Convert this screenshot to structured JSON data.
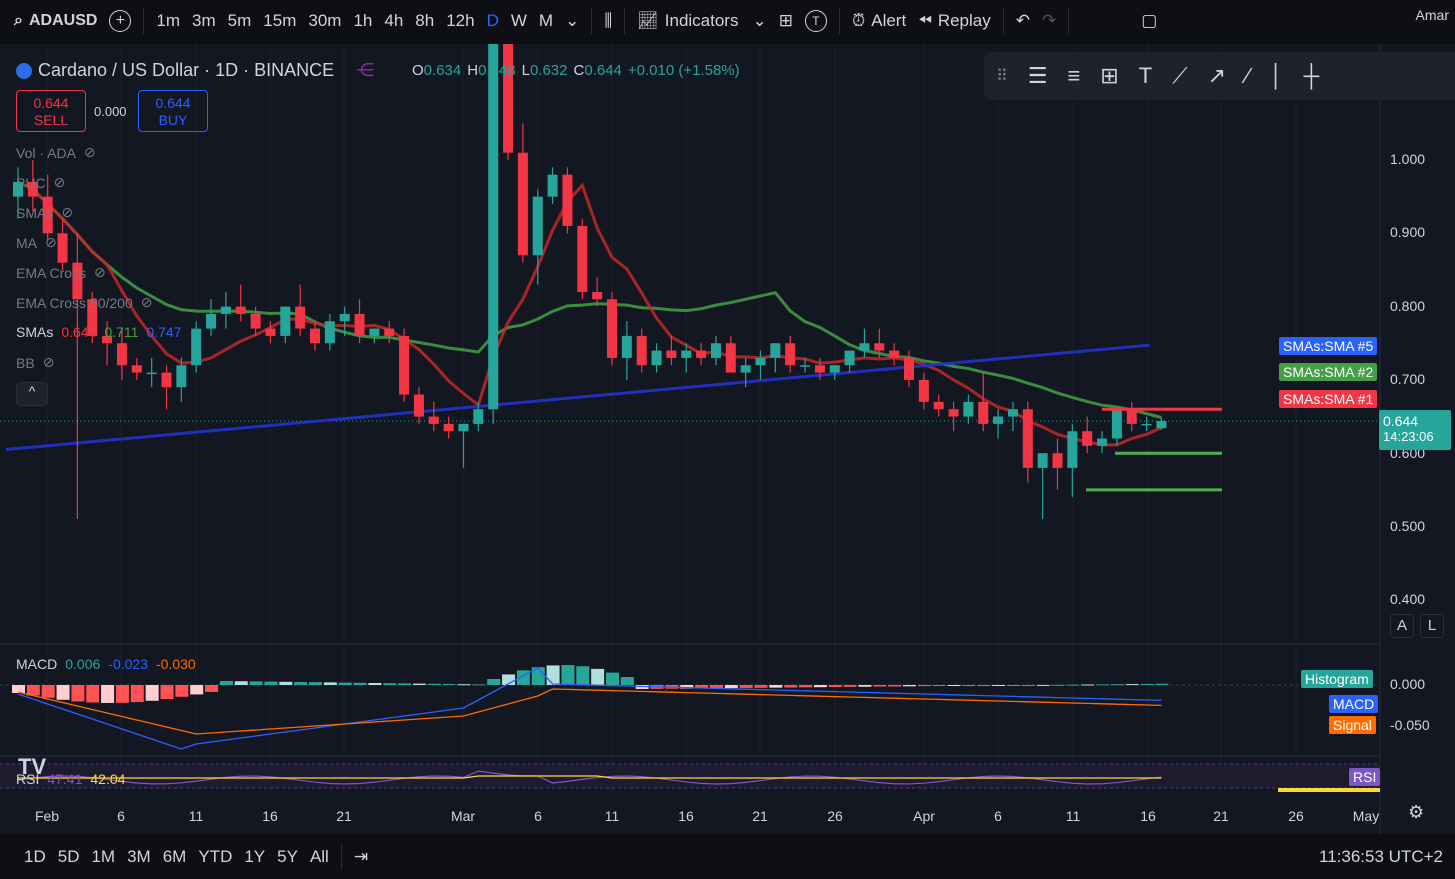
{
  "topbar": {
    "symbol": "ADAUSD",
    "intervals": [
      "1m",
      "3m",
      "5m",
      "15m",
      "30m",
      "1h",
      "4h",
      "8h",
      "12h",
      "D",
      "W",
      "M"
    ],
    "active_interval": "D",
    "indicators_label": "Indicators",
    "alert_label": "Alert",
    "replay_label": "Replay",
    "t_badge": "T",
    "user_partial": "Amar"
  },
  "legend": {
    "title": "Cardano / US Dollar · 1D · BINANCE",
    "ohlc": {
      "o_key": "O",
      "o": "0.634",
      "h_key": "H",
      "h": "0.648",
      "l_key": "L",
      "l": "0.632",
      "c_key": "C",
      "c": "0.644",
      "change": "+0.010 (+1.58%)"
    },
    "sell": {
      "price": "0.644",
      "label": "SELL"
    },
    "buy": {
      "price": "0.644",
      "label": "BUY"
    },
    "spread": "0.000",
    "indicators": [
      {
        "name": "Vol · ADA"
      },
      {
        "name": "PUC"
      },
      {
        "name": "SMAs"
      },
      {
        "name": "MA"
      },
      {
        "name": "EMA Cross"
      },
      {
        "name": "EMA Cross 50/200"
      }
    ],
    "smas_row": {
      "name": "SMAs",
      "v1": "0.644",
      "v2": "0.711",
      "v3": "0.747"
    },
    "bb_row": {
      "name": "BB"
    },
    "collapse": "^"
  },
  "price_axis": {
    "labels": [
      "1.000",
      "0.900",
      "0.800",
      "0.700",
      "0.600",
      "0.500",
      "0.400"
    ],
    "current_price": "0.644",
    "countdown": "14:23:06",
    "tags": {
      "sma5": "SMAs:SMA #5",
      "sma2": "SMAs:SMA #2",
      "sma1": "SMAs:SMA #1"
    },
    "auto": "A",
    "log": "L"
  },
  "macd": {
    "label": "MACD",
    "v1": "0.006",
    "v2": "-0.023",
    "v3": "-0.030",
    "axis": [
      "0.000",
      "-0.050"
    ],
    "tags": {
      "hist": "Histogram",
      "macd": "MACD",
      "signal": "Signal"
    }
  },
  "rsi": {
    "label": "RSI",
    "v1": "47.41",
    "v2": "42.04",
    "tag": "RSI"
  },
  "time_axis": [
    "Feb",
    "6",
    "11",
    "16",
    "21",
    "Mar",
    "6",
    "11",
    "16",
    "21",
    "26",
    "Apr",
    "6",
    "11",
    "16",
    "21",
    "26",
    "May"
  ],
  "bottombar": {
    "ranges": [
      "1D",
      "5D",
      "1M",
      "3M",
      "6M",
      "YTD",
      "1Y",
      "5Y",
      "All"
    ],
    "clock": "11:36:53 UTC+2"
  },
  "colors": {
    "up": "#26a69a",
    "down": "#f23645",
    "bg": "#131722",
    "sma_green": "#43a047",
    "sma_red": "#c62828",
    "sma_blue": "#2233cc"
  },
  "chart_data": {
    "type": "candlestick",
    "x": [
      "Jan 28",
      "Jan 29",
      "Jan 30",
      "Jan 31",
      "Feb 1",
      "Feb 2",
      "Feb 3",
      "Feb 4",
      "Feb 5",
      "Feb 6",
      "Feb 7",
      "Feb 8",
      "Feb 9",
      "Feb 10",
      "Feb 11",
      "Feb 12",
      "Feb 13",
      "Feb 14",
      "Feb 15",
      "Feb 16",
      "Feb 17",
      "Feb 18",
      "Feb 19",
      "Feb 20",
      "Feb 21",
      "Feb 22",
      "Feb 23",
      "Feb 24",
      "Feb 25",
      "Feb 26",
      "Feb 27",
      "Feb 28",
      "Mar 1",
      "Mar 2",
      "Mar 3",
      "Mar 4",
      "Mar 5",
      "Mar 6",
      "Mar 7",
      "Mar 8",
      "Mar 9",
      "Mar 10",
      "Mar 11",
      "Mar 12",
      "Mar 13",
      "Mar 14",
      "Mar 15",
      "Mar 16",
      "Mar 17",
      "Mar 18",
      "Mar 19",
      "Mar 20",
      "Mar 21",
      "Mar 22",
      "Mar 23",
      "Mar 24",
      "Mar 25",
      "Mar 26",
      "Mar 27",
      "Mar 28",
      "Mar 29",
      "Mar 30",
      "Mar 31",
      "Apr 1",
      "Apr 2",
      "Apr 3",
      "Apr 4",
      "Apr 5",
      "Apr 6",
      "Apr 7",
      "Apr 8",
      "Apr 9",
      "Apr 10",
      "Apr 11",
      "Apr 12",
      "Apr 13",
      "Apr 14",
      "Apr 15"
    ],
    "ohlc": [
      [
        0.95,
        0.99,
        0.92,
        0.97
      ],
      [
        0.97,
        1.0,
        0.93,
        0.95
      ],
      [
        0.95,
        0.98,
        0.89,
        0.9
      ],
      [
        0.9,
        0.92,
        0.85,
        0.86
      ],
      [
        0.86,
        0.9,
        0.51,
        0.81
      ],
      [
        0.81,
        0.82,
        0.75,
        0.76
      ],
      [
        0.76,
        0.78,
        0.72,
        0.75
      ],
      [
        0.75,
        0.77,
        0.7,
        0.72
      ],
      [
        0.72,
        0.73,
        0.7,
        0.71
      ],
      [
        0.71,
        0.73,
        0.69,
        0.71
      ],
      [
        0.71,
        0.72,
        0.66,
        0.69
      ],
      [
        0.69,
        0.73,
        0.67,
        0.72
      ],
      [
        0.72,
        0.78,
        0.71,
        0.77
      ],
      [
        0.77,
        0.81,
        0.76,
        0.79
      ],
      [
        0.79,
        0.82,
        0.77,
        0.8
      ],
      [
        0.8,
        0.83,
        0.78,
        0.79
      ],
      [
        0.79,
        0.8,
        0.76,
        0.77
      ],
      [
        0.77,
        0.78,
        0.75,
        0.76
      ],
      [
        0.76,
        0.8,
        0.75,
        0.8
      ],
      [
        0.8,
        0.83,
        0.76,
        0.77
      ],
      [
        0.77,
        0.78,
        0.74,
        0.75
      ],
      [
        0.75,
        0.79,
        0.74,
        0.78
      ],
      [
        0.78,
        0.8,
        0.76,
        0.79
      ],
      [
        0.79,
        0.81,
        0.75,
        0.76
      ],
      [
        0.76,
        0.77,
        0.75,
        0.77
      ],
      [
        0.77,
        0.78,
        0.75,
        0.76
      ],
      [
        0.76,
        0.77,
        0.67,
        0.68
      ],
      [
        0.68,
        0.69,
        0.64,
        0.65
      ],
      [
        0.65,
        0.67,
        0.63,
        0.64
      ],
      [
        0.64,
        0.65,
        0.62,
        0.63
      ],
      [
        0.63,
        0.64,
        0.58,
        0.64
      ],
      [
        0.64,
        0.67,
        0.63,
        0.66
      ],
      [
        0.66,
        1.27,
        0.64,
        1.22
      ],
      [
        1.22,
        1.28,
        1.0,
        1.01
      ],
      [
        1.01,
        1.05,
        0.86,
        0.87
      ],
      [
        0.87,
        0.96,
        0.83,
        0.95
      ],
      [
        0.95,
        0.99,
        0.94,
        0.98
      ],
      [
        0.98,
        0.99,
        0.9,
        0.91
      ],
      [
        0.91,
        0.92,
        0.81,
        0.82
      ],
      [
        0.82,
        0.84,
        0.8,
        0.81
      ],
      [
        0.81,
        0.82,
        0.72,
        0.73
      ],
      [
        0.73,
        0.78,
        0.7,
        0.76
      ],
      [
        0.76,
        0.77,
        0.71,
        0.72
      ],
      [
        0.72,
        0.75,
        0.71,
        0.74
      ],
      [
        0.74,
        0.76,
        0.72,
        0.73
      ],
      [
        0.73,
        0.75,
        0.71,
        0.74
      ],
      [
        0.74,
        0.75,
        0.72,
        0.73
      ],
      [
        0.73,
        0.76,
        0.72,
        0.75
      ],
      [
        0.75,
        0.76,
        0.71,
        0.71
      ],
      [
        0.71,
        0.73,
        0.69,
        0.72
      ],
      [
        0.72,
        0.74,
        0.7,
        0.73
      ],
      [
        0.73,
        0.75,
        0.71,
        0.75
      ],
      [
        0.75,
        0.76,
        0.71,
        0.72
      ],
      [
        0.72,
        0.73,
        0.71,
        0.72
      ],
      [
        0.72,
        0.73,
        0.7,
        0.71
      ],
      [
        0.71,
        0.72,
        0.7,
        0.72
      ],
      [
        0.72,
        0.74,
        0.71,
        0.74
      ],
      [
        0.74,
        0.77,
        0.73,
        0.75
      ],
      [
        0.75,
        0.77,
        0.73,
        0.74
      ],
      [
        0.74,
        0.75,
        0.72,
        0.73
      ],
      [
        0.73,
        0.74,
        0.69,
        0.7
      ],
      [
        0.7,
        0.71,
        0.66,
        0.67
      ],
      [
        0.67,
        0.68,
        0.65,
        0.66
      ],
      [
        0.66,
        0.67,
        0.63,
        0.65
      ],
      [
        0.65,
        0.68,
        0.64,
        0.67
      ],
      [
        0.67,
        0.71,
        0.63,
        0.64
      ],
      [
        0.64,
        0.66,
        0.62,
        0.65
      ],
      [
        0.65,
        0.67,
        0.63,
        0.66
      ],
      [
        0.66,
        0.67,
        0.56,
        0.58
      ],
      [
        0.58,
        0.6,
        0.51,
        0.6
      ],
      [
        0.6,
        0.62,
        0.55,
        0.58
      ],
      [
        0.58,
        0.64,
        0.54,
        0.63
      ],
      [
        0.63,
        0.65,
        0.6,
        0.61
      ],
      [
        0.61,
        0.63,
        0.6,
        0.62
      ],
      [
        0.62,
        0.66,
        0.61,
        0.66
      ],
      [
        0.66,
        0.67,
        0.63,
        0.64
      ],
      [
        0.64,
        0.65,
        0.63,
        0.64
      ],
      [
        0.634,
        0.648,
        0.632,
        0.644
      ]
    ],
    "series": [
      {
        "name": "SMAs:SMA #1",
        "color": "#c62828"
      },
      {
        "name": "SMAs:SMA #2",
        "color": "#43a047"
      },
      {
        "name": "SMAs:SMA #5",
        "color": "#2233cc"
      }
    ],
    "ylim": [
      0.35,
      1.2
    ]
  }
}
